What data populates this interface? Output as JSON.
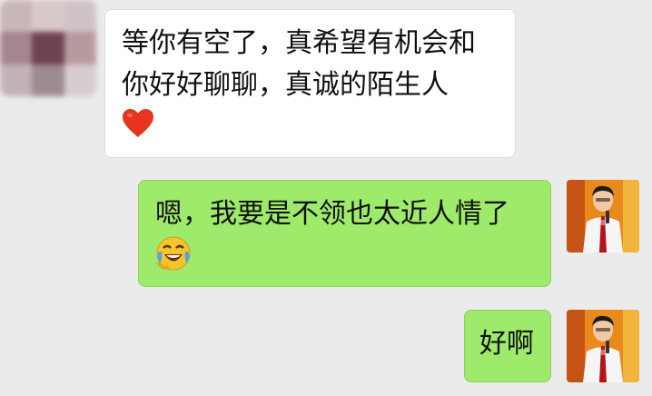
{
  "messages": [
    {
      "side": "left",
      "text_line1": "等你有空了，真希望有机会和",
      "text_line2": "你好好聊聊，真诚的陌生人",
      "emoji": "red-heart"
    },
    {
      "side": "right",
      "text_line1": "嗯，我要是不领也太近人情了",
      "emoji": "face-with-tears-of-joy"
    },
    {
      "side": "right",
      "text_line1": "好啊"
    }
  ],
  "colors": {
    "background": "#ebebeb",
    "bubble_incoming": "#ffffff",
    "bubble_outgoing": "#9eea6a"
  }
}
